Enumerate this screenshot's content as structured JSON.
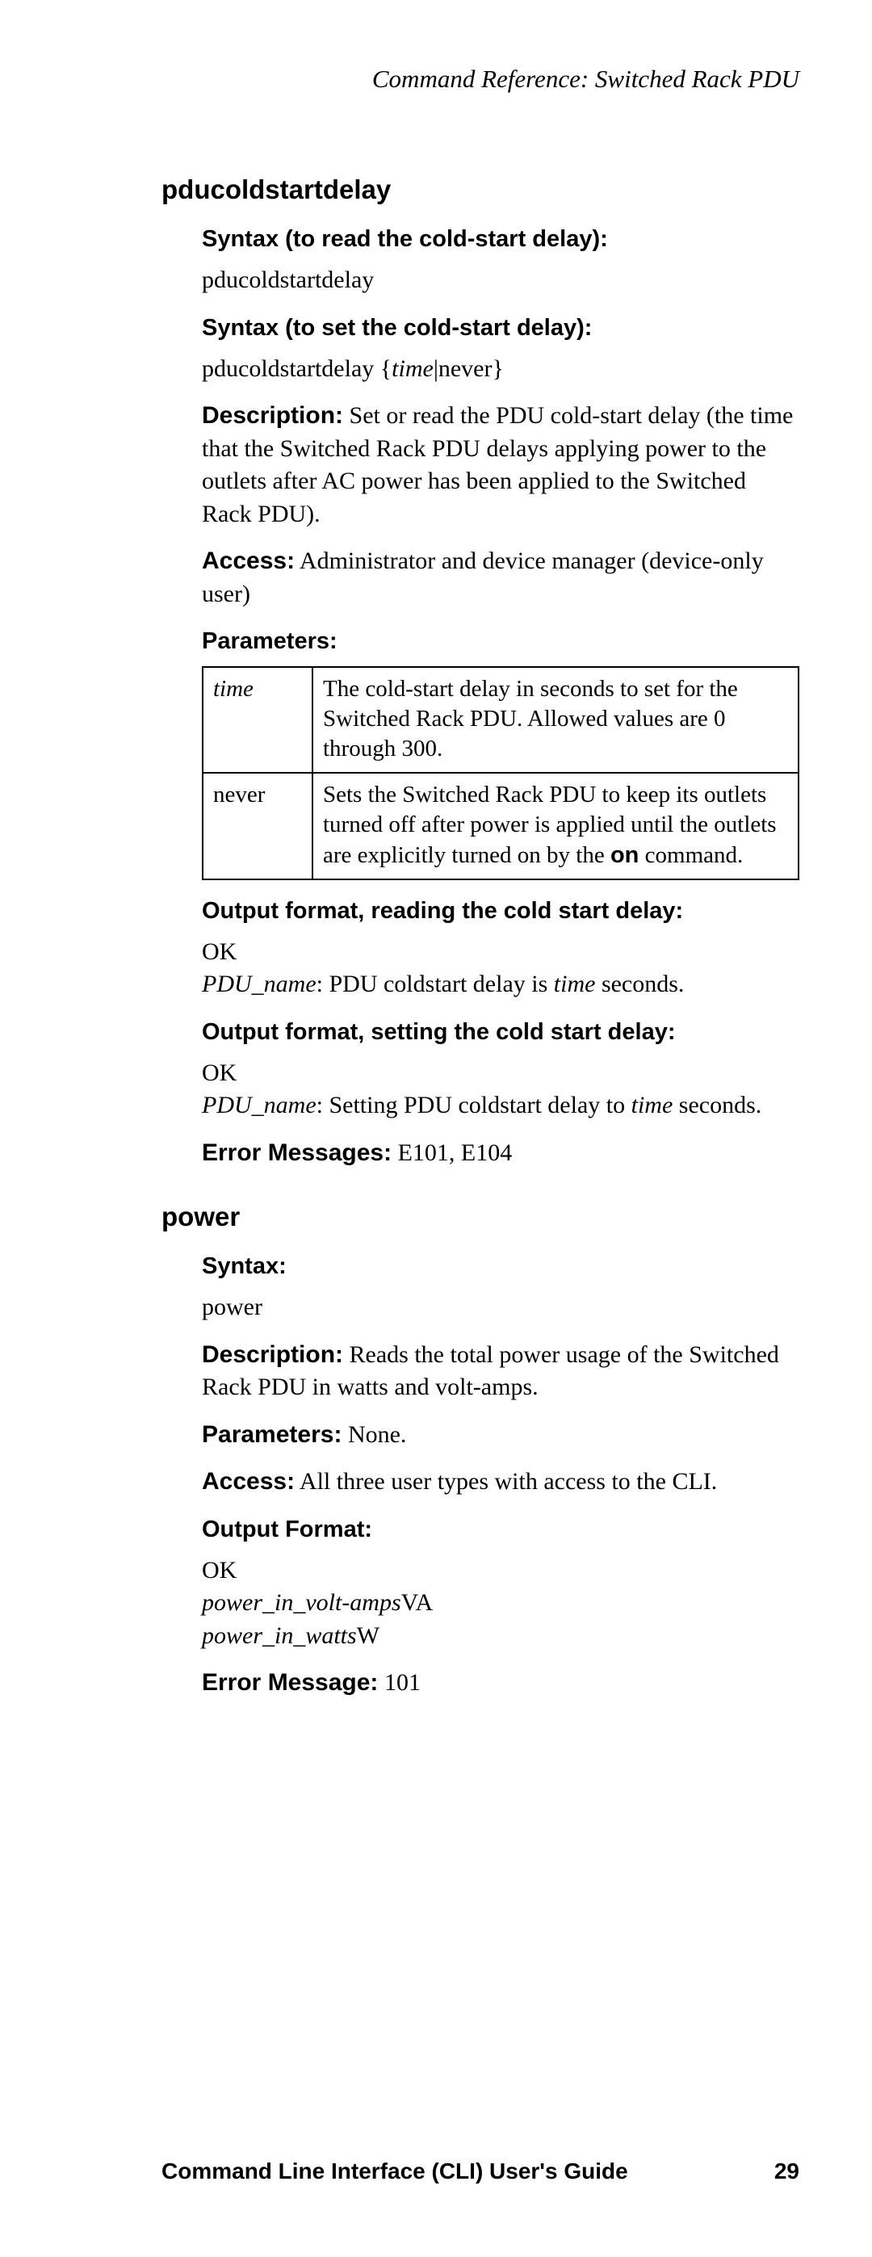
{
  "header": "Command Reference: Switched Rack PDU",
  "cmd1": {
    "name": "pducoldstartdelay",
    "syntax_read_label": "Syntax (to read the cold-start delay):",
    "syntax_read_val": "pducoldstartdelay",
    "syntax_set_label": "Syntax (to set the cold-start delay):",
    "syntax_set_prefix": "pducoldstartdelay {",
    "syntax_set_time": "time",
    "syntax_set_suffix": "|never}",
    "description_label": "Description:",
    "description": " Set or read the PDU cold-start delay (the time that the Switched Rack PDU delays applying power to the outlets after AC power has been applied to the Switched Rack PDU).",
    "access_label": "Access:",
    "access": " Administrator and device manager (device-only user)",
    "parameters_label": "Parameters:",
    "table": {
      "r1k": "time",
      "r1v": "The cold-start delay in seconds to set for the Switched Rack PDU. Allowed values are 0 through 300.",
      "r2k": "never",
      "r2v_a": "Sets the Switched Rack PDU to keep its outlets turned off after power is applied until the outlets are explicitly turned on by the ",
      "r2v_on": "on",
      "r2v_b": " command."
    },
    "out_read_label": "Output format, reading the cold start delay:",
    "out_read_ok": "OK",
    "out_read_pduname": "PDU_name",
    "out_read_mid": ": PDU coldstart delay is ",
    "out_read_time": "time",
    "out_read_end": " seconds.",
    "out_set_label": "Output format, setting the cold start delay:",
    "out_set_ok": "OK",
    "out_set_pduname": "PDU_name",
    "out_set_mid": ": Setting PDU coldstart delay to ",
    "out_set_time": "time",
    "out_set_end": " seconds.",
    "err_label": "Error Messages:",
    "err_val": " E101, E104"
  },
  "cmd2": {
    "name": "power",
    "syntax_label": "Syntax:",
    "syntax_val": "power",
    "description_label": "Description:",
    "description": " Reads the total power usage of the Switched Rack PDU in watts and volt-amps.",
    "parameters_label": "Parameters:",
    "parameters_val": " None.",
    "access_label": "Access:",
    "access": "  All three user types with access to the CLI.",
    "out_label": "Output Format:",
    "out_ok": "OK",
    "out_va_i": "power_in_volt-amps",
    "out_va_suffix": "VA",
    "out_w_i": "power_in_watts",
    "out_w_suffix": "W",
    "err_label": "Error Message:",
    "err_val": " 101"
  },
  "footer": {
    "title": "Command Line Interface (CLI) User's Guide",
    "page": "29"
  }
}
